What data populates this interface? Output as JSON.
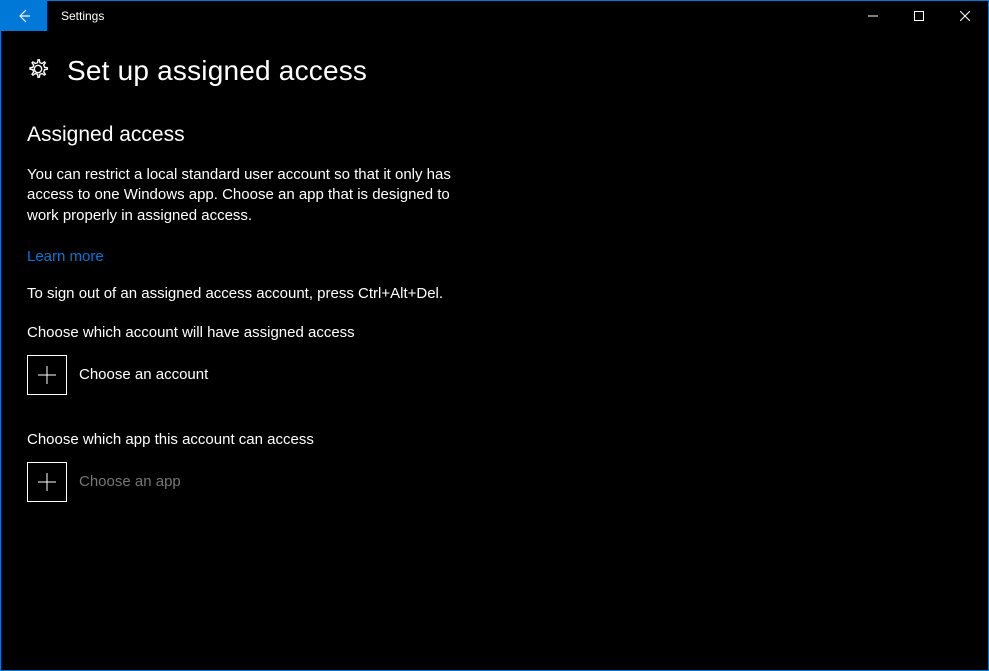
{
  "titlebar": {
    "app_name": "Settings"
  },
  "header": {
    "title": "Set up assigned access"
  },
  "main": {
    "section_title": "Assigned access",
    "description": "You can restrict a local standard user account so that it only has access to one Windows app. Choose an app that is designed to work properly in assigned access.",
    "learn_more": "Learn more",
    "signout_text": "To sign out of an assigned access account, press Ctrl+Alt+Del.",
    "choose_account_label": "Choose which account will have assigned access",
    "choose_account_button": "Choose an account",
    "choose_app_label": "Choose which app this account can access",
    "choose_app_button": "Choose an app"
  }
}
